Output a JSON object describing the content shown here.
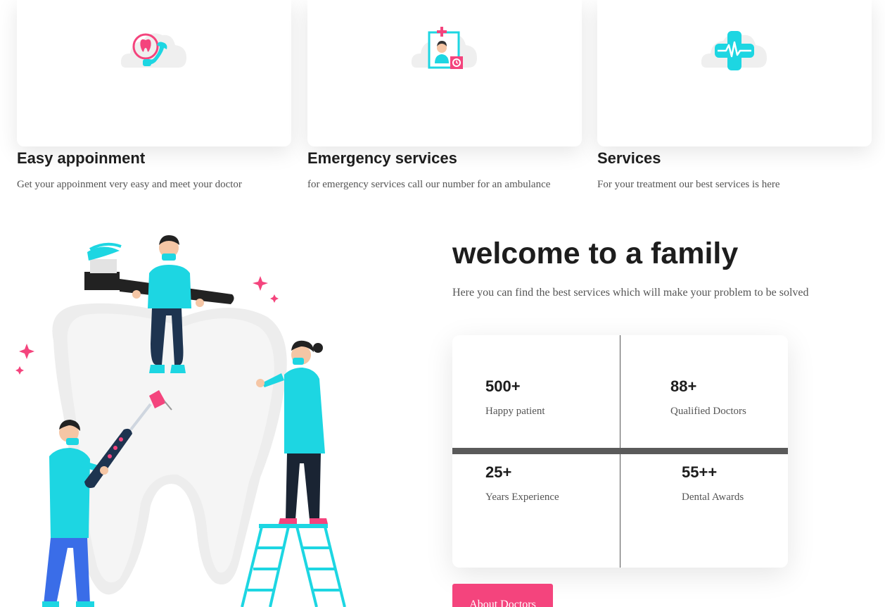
{
  "services": [
    {
      "title": "Easy appoinment",
      "description": "Get your appoinment very easy and meet your doctor",
      "icon": "phone-tooth-icon"
    },
    {
      "title": "Emergency services",
      "description": "for emergency services call our number for an ambulance",
      "icon": "doctor-clock-icon"
    },
    {
      "title": "Services",
      "description": "For your treatment our best services is here",
      "icon": "medical-cross-pulse-icon"
    }
  ],
  "welcome": {
    "title": "welcome to a family",
    "subtitle": "Here you can find the best services which will make your problem to be solved"
  },
  "stats": [
    {
      "value": "500+",
      "label": "Happy patient"
    },
    {
      "value": "88+",
      "label": "Qualified Doctors"
    },
    {
      "value": "25+",
      "label": "Years Experience"
    },
    {
      "value": "55++",
      "label": "Dental Awards"
    }
  ],
  "cta": {
    "label": "About Doctors"
  },
  "colors": {
    "accent_pink": "#f4447d",
    "accent_cyan": "#1dd6e2",
    "dark_text": "#1d1d1d",
    "body_text": "#555555"
  }
}
